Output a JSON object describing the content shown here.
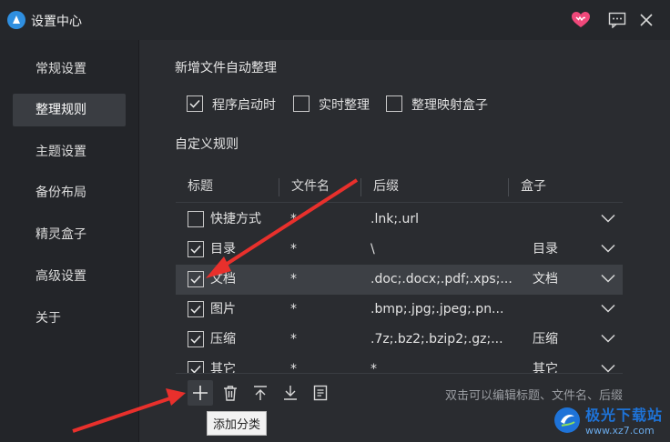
{
  "window": {
    "title": "设置中心",
    "accent": "#2f8fe0",
    "heart_color": "#f0487a"
  },
  "sidebar": {
    "items": [
      {
        "label": "常规设置",
        "active": false
      },
      {
        "label": "整理规则",
        "active": true
      },
      {
        "label": "主题设置",
        "active": false
      },
      {
        "label": "备份布局",
        "active": false
      },
      {
        "label": "精灵盒子",
        "active": false
      },
      {
        "label": "高级设置",
        "active": false
      },
      {
        "label": "关于",
        "active": false
      }
    ]
  },
  "auto_organize": {
    "title": "新增文件自动整理",
    "options": [
      {
        "label": "程序启动时",
        "checked": true
      },
      {
        "label": "实时整理",
        "checked": false
      },
      {
        "label": "整理映射盒子",
        "checked": false
      }
    ]
  },
  "custom_rules": {
    "title": "自定义规则",
    "columns": [
      "标题",
      "文件名",
      "后缀",
      "盒子"
    ],
    "rows": [
      {
        "checked": false,
        "title": "快捷方式",
        "filename": "*",
        "suffix": ".lnk;.url",
        "box": "",
        "selected": false
      },
      {
        "checked": true,
        "title": "目录",
        "filename": "*",
        "suffix": "\\",
        "box": "目录",
        "selected": false
      },
      {
        "checked": true,
        "title": "文档",
        "filename": "*",
        "suffix": ".doc;.docx;.pdf;.xps;...",
        "box": "文档",
        "selected": true
      },
      {
        "checked": true,
        "title": "图片",
        "filename": "*",
        "suffix": ".bmp;.jpg;.jpeg;.pn...",
        "box": "",
        "selected": false
      },
      {
        "checked": true,
        "title": "压缩",
        "filename": "*",
        "suffix": ".7z;.bz2;.bzip2;.gz;...",
        "box": "压缩",
        "selected": false
      },
      {
        "checked": true,
        "title": "其它",
        "filename": "*",
        "suffix": "*",
        "box": "其它",
        "selected": false
      }
    ]
  },
  "toolbar": {
    "buttons": [
      "add-icon",
      "delete-icon",
      "move-top-icon",
      "download-icon",
      "list-icon"
    ],
    "hint": "双击可以编辑标题、文件名、后缀",
    "tooltip": "添加分类"
  },
  "watermark": {
    "name": "极光下载站",
    "url": "www.xz7.com"
  }
}
